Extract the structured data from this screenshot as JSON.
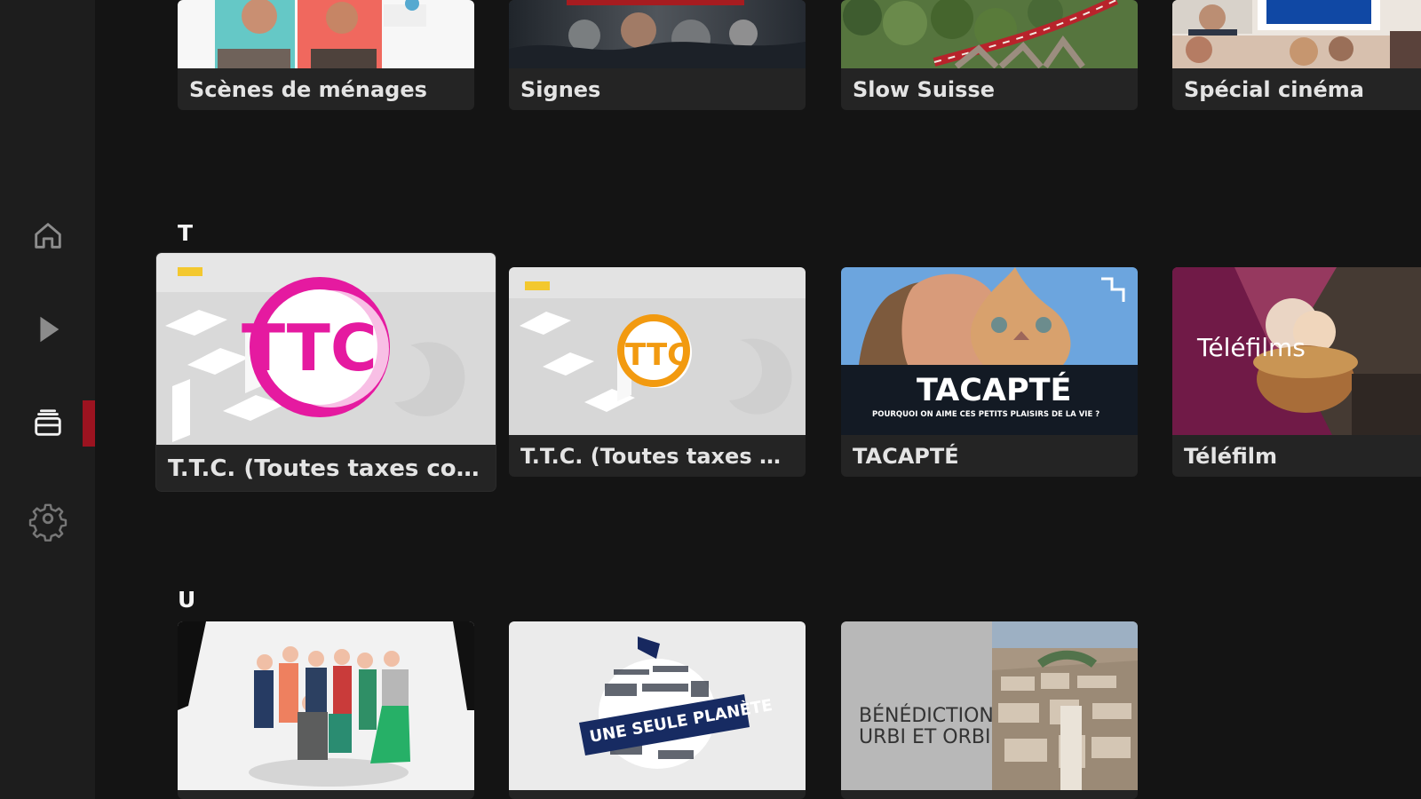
{
  "sections": [
    {
      "letter": ""
    },
    {
      "letter": "T"
    },
    {
      "letter": "U"
    }
  ],
  "rows": {
    "s": [
      {
        "title": "Scènes de ménages"
      },
      {
        "title": "Signes"
      },
      {
        "title": "Slow Suisse"
      },
      {
        "title": "Spécial cinéma"
      }
    ],
    "t": [
      {
        "title": "T.T.C. (Toutes taxes com...",
        "logo_text": "TTC",
        "selected": true
      },
      {
        "title": "T.T.C. (Toutes taxes com...",
        "logo_text": "TTC"
      },
      {
        "title": "TACAPTÉ",
        "thumb_title": "TACAPTÉ",
        "thumb_subtitle": "POURQUOI ON AIME CES PETITS PLAISIRS DE LA VIE ?"
      },
      {
        "title": "Téléfilm",
        "thumb_title": "Téléfilms"
      }
    ],
    "u": [
      {
        "title": ""
      },
      {
        "title": "",
        "thumb_title": "UNE SEULE PLANÈTE"
      },
      {
        "title": "",
        "thumb_title_line1": "BÉNÉDICTION",
        "thumb_title_line2": "URBI ET ORBI"
      }
    ]
  },
  "colors": {
    "background": "#141414",
    "sidebar": "#1d1d1d",
    "card": "#242424",
    "accent": "#9c1320",
    "ttc_pink": "#e51aa0",
    "ttc_orange": "#f29a10"
  },
  "icons": {
    "home": "home-icon",
    "play": "play-icon",
    "library": "library-icon",
    "settings": "gear-icon"
  }
}
